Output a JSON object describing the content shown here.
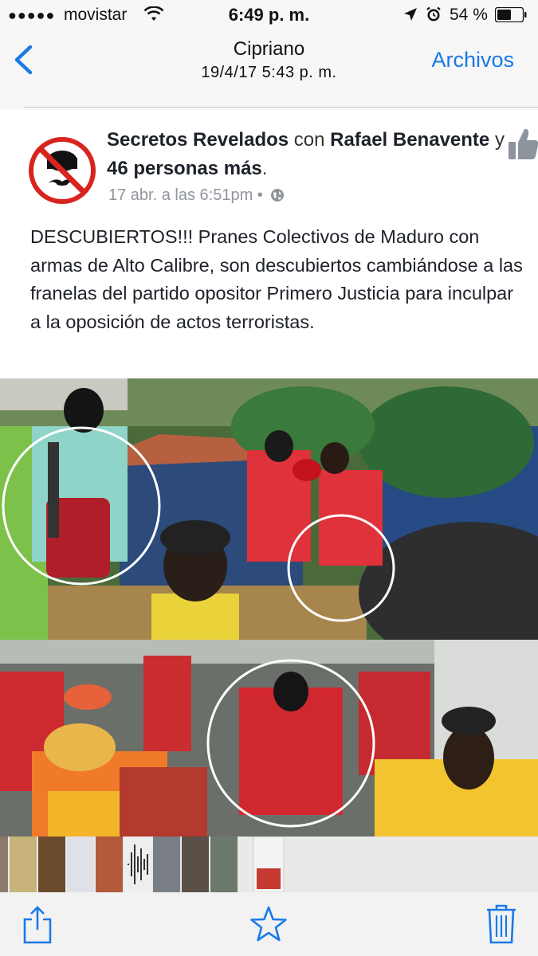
{
  "status_bar": {
    "carrier": "movistar",
    "time": "6:49 p. m.",
    "battery": "54 %"
  },
  "nav": {
    "title": "Cipriano",
    "subtitle": "19/4/17 5:43 p. m.",
    "right_button": "Archivos"
  },
  "post": {
    "page_name": "Secretos Revelados",
    "connector": "con",
    "tagged_name": "Rafael Benavente",
    "and_word": "y",
    "others": "46 personas más",
    "end_punct": ".",
    "timestamp": "17 abr. a las 6:51pm",
    "separator": "•",
    "text": "DESCUBIERTOS!!! Pranes Colectivos de Maduro con armas de Alto Calibre, son descubiertos cambiándose a las franelas del partido opositor Primero Justicia para inculpar a la oposición de actos terroristas."
  },
  "icons": {
    "back": "chevron-left-icon",
    "like": "thumbs-up-icon",
    "privacy": "globe-icon",
    "share": "share-icon",
    "favorite": "star-icon",
    "delete": "trash-icon"
  },
  "colors": {
    "accent": "#1a7ae6",
    "meta_text": "#90949c",
    "body_text": "#1d2129"
  }
}
